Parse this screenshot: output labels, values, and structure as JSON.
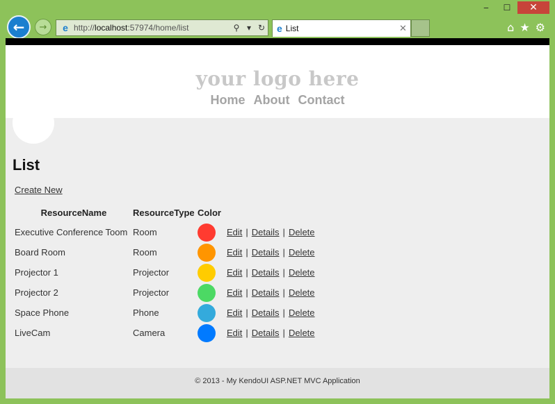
{
  "browser": {
    "url_prefix": "http://",
    "url_host": "localhost",
    "url_rest": ":57974/home/list",
    "tab_title": "List",
    "tab_close": "✕",
    "win_min": "‒",
    "win_max": "☐",
    "win_close": "✕"
  },
  "site": {
    "logo": "your logo here",
    "nav": [
      "Home",
      "About",
      "Contact"
    ]
  },
  "page": {
    "title": "List",
    "create_new": "Create New"
  },
  "table": {
    "headers": [
      "ResourceName",
      "ResourceType",
      "Color"
    ],
    "rows": [
      {
        "name": "Executive Conference Toom",
        "type": "Room",
        "color": "#ff3b30"
      },
      {
        "name": "Board Room",
        "type": "Room",
        "color": "#ff9500"
      },
      {
        "name": "Projector 1",
        "type": "Projector",
        "color": "#ffcc00"
      },
      {
        "name": "Projector 2",
        "type": "Projector",
        "color": "#4cd964"
      },
      {
        "name": "Space Phone",
        "type": "Phone",
        "color": "#34aadc"
      },
      {
        "name": "LiveCam",
        "type": "Camera",
        "color": "#007aff"
      }
    ],
    "actions": {
      "edit": "Edit",
      "details": "Details",
      "delete": "Delete",
      "sep": "|"
    }
  },
  "footer": {
    "text": "© 2013 - My KendoUI ASP.NET MVC Application"
  }
}
